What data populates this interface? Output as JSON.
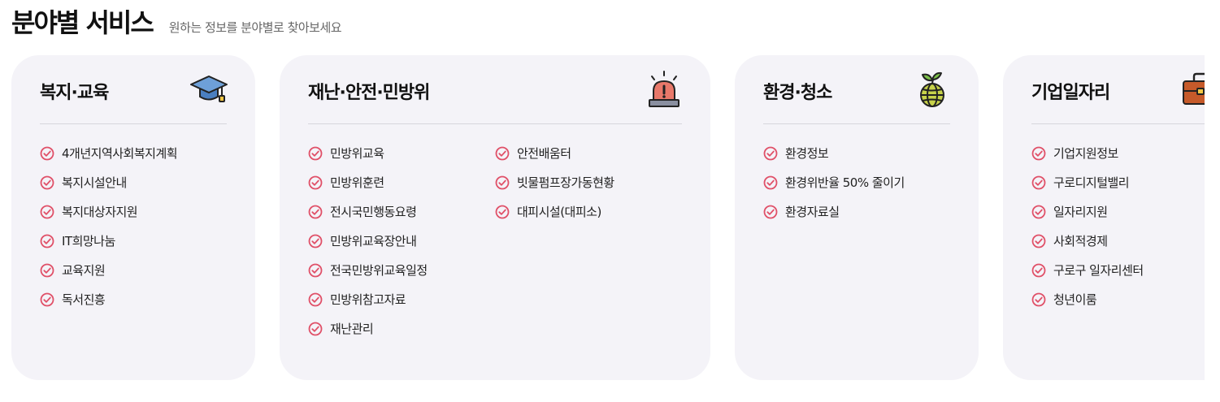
{
  "header": {
    "title": "분야별 서비스",
    "subtitle": "원하는 정보를 분야별로 찾아보세요"
  },
  "accent_color": "#e05068",
  "cards": [
    {
      "title": "복지·교육",
      "icon": "graduation-cap-icon",
      "items": [
        "4개년지역사회복지계획",
        "복지시설안내",
        "복지대상자지원",
        "IT희망나눔",
        "교육지원",
        "독서진흥"
      ]
    },
    {
      "title": "재난·안전·민방위",
      "icon": "siren-icon",
      "items": [
        "민방위교육",
        "민방위훈련",
        "전시국민행동요령",
        "민방위교육장안내",
        "전국민방위교육일정",
        "민방위참고자료",
        "재난관리"
      ],
      "items2": [
        "안전배움터",
        "빗물펌프장가동현황",
        "대피시설(대피소)"
      ]
    },
    {
      "title": "환경·청소",
      "icon": "globe-sprout-icon",
      "items": [
        "환경정보",
        "환경위반율 50% 줄이기",
        "환경자료실"
      ]
    },
    {
      "title": "기업일자리",
      "icon": "briefcase-icon",
      "items": [
        "기업지원정보",
        "구로디지털밸리",
        "일자리지원",
        "사회적경제",
        "구로구 일자리센터",
        "청년이룸"
      ]
    }
  ]
}
